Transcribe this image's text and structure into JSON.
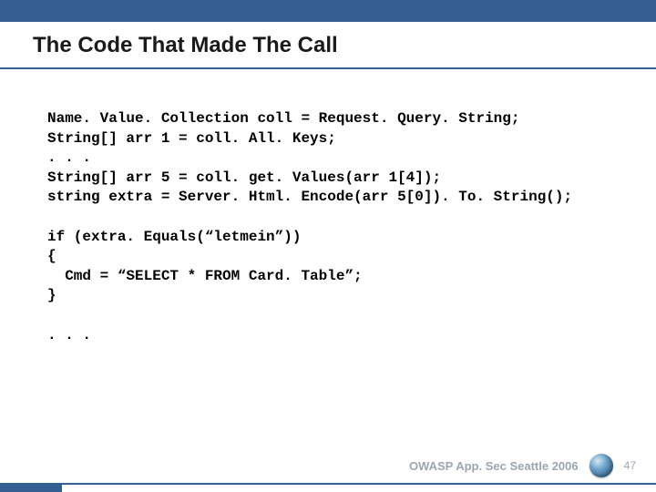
{
  "title": "The Code That Made The Call",
  "code": {
    "l1": "Name. Value. Collection coll = Request. Query. String;",
    "l2": "String[] arr 1 = coll. All. Keys;",
    "l3": ". . .",
    "l4": "String[] arr 5 = coll. get. Values(arr 1[4]);",
    "l5": "string extra = Server. Html. Encode(arr 5[0]). To. String();",
    "l6": "",
    "l7": "if (extra. Equals(“letmein”))",
    "l8": "{",
    "l9": "  Cmd = “SELECT * FROM Card. Table”;",
    "l10": "}",
    "l11": "",
    "l12": ". . ."
  },
  "footer": {
    "event": "OWASP App. Sec Seattle 2006",
    "page": "47"
  }
}
